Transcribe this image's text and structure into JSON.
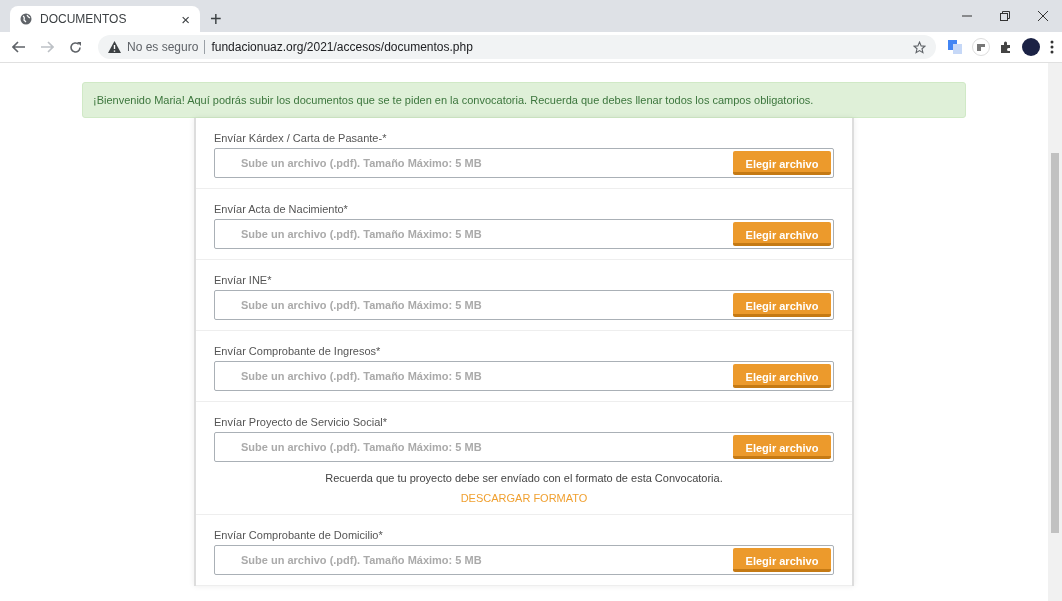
{
  "browser": {
    "tab": {
      "title": "DOCUMENTOS",
      "close": "×",
      "selected": true
    },
    "new_tab": "+",
    "insecure_label": "No es seguro",
    "url": "fundacionuaz.org/2021/accesos/documentos.php",
    "forward_disabled": true
  },
  "alert": {
    "text": "¡Bienvenido Maria! Aquí podrás subir los documentos que se te piden en la convocatoria. Recuerda que debes llenar todos los campos obligatorios."
  },
  "uploads": [
    {
      "label": "Envíar Kárdex / Carta de Pasante-*",
      "placeholder": "Sube un archivo (.pdf). Tamaño Máximo: 5 MB",
      "button": "Elegir archivo"
    },
    {
      "label": "Envíar Acta de Nacimiento*",
      "placeholder": "Sube un archivo (.pdf). Tamaño Máximo: 5 MB",
      "button": "Elegir archivo"
    },
    {
      "label": "Envíar INE*",
      "placeholder": "Sube un archivo (.pdf). Tamaño Máximo: 5 MB",
      "button": "Elegir archivo"
    },
    {
      "label": "Envíar Comprobante de Ingresos*",
      "placeholder": "Sube un archivo (.pdf). Tamaño Máximo: 5 MB",
      "button": "Elegir archivo"
    },
    {
      "label": "Envíar Proyecto de Servicio Social*",
      "placeholder": "Sube un archivo (.pdf). Tamaño Máximo: 5 MB",
      "button": "Elegir archivo",
      "note": "Recuerda que tu proyecto debe ser envíado con el formato de esta Convocatoria.",
      "link": "DESCARGAR FORMATO"
    },
    {
      "label": "Envíar Comprobante de Domicilio*",
      "placeholder": "Sube un archivo (.pdf). Tamaño Máximo: 5 MB",
      "button": "Elegir archivo"
    }
  ]
}
